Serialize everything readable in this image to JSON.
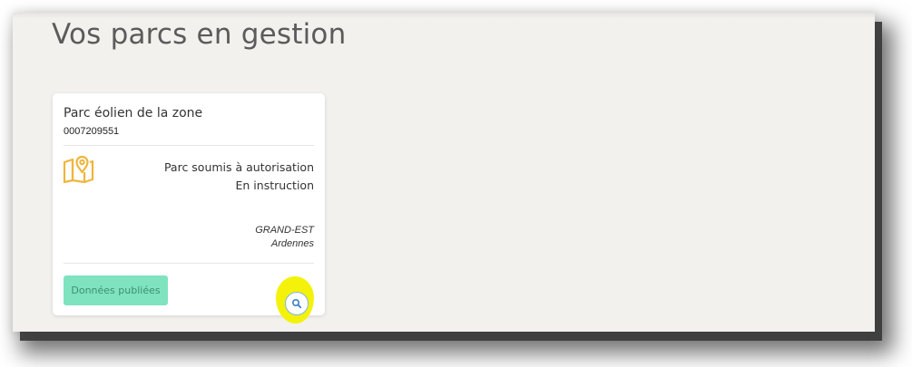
{
  "page": {
    "title": "Vos parcs en gestion"
  },
  "card": {
    "name": "Parc éolien de la zone",
    "code": "0007209551",
    "map_icon": "map-pin-icon",
    "status_type": "Parc soumis à autorisation",
    "status_state": "En instruction",
    "region": "GRAND-EST",
    "department": "Ardennes",
    "published_label": "Données publiées",
    "search_icon": "magnifier-icon"
  },
  "colors": {
    "background": "#f2f1ee",
    "card": "#ffffff",
    "title": "#5b5b5b",
    "map_icon": "#f0b53c",
    "published_button": "#7fe3c0",
    "published_text": "#3d8f73",
    "highlight": "#f4f20a",
    "search_border": "#7fb6e6"
  }
}
